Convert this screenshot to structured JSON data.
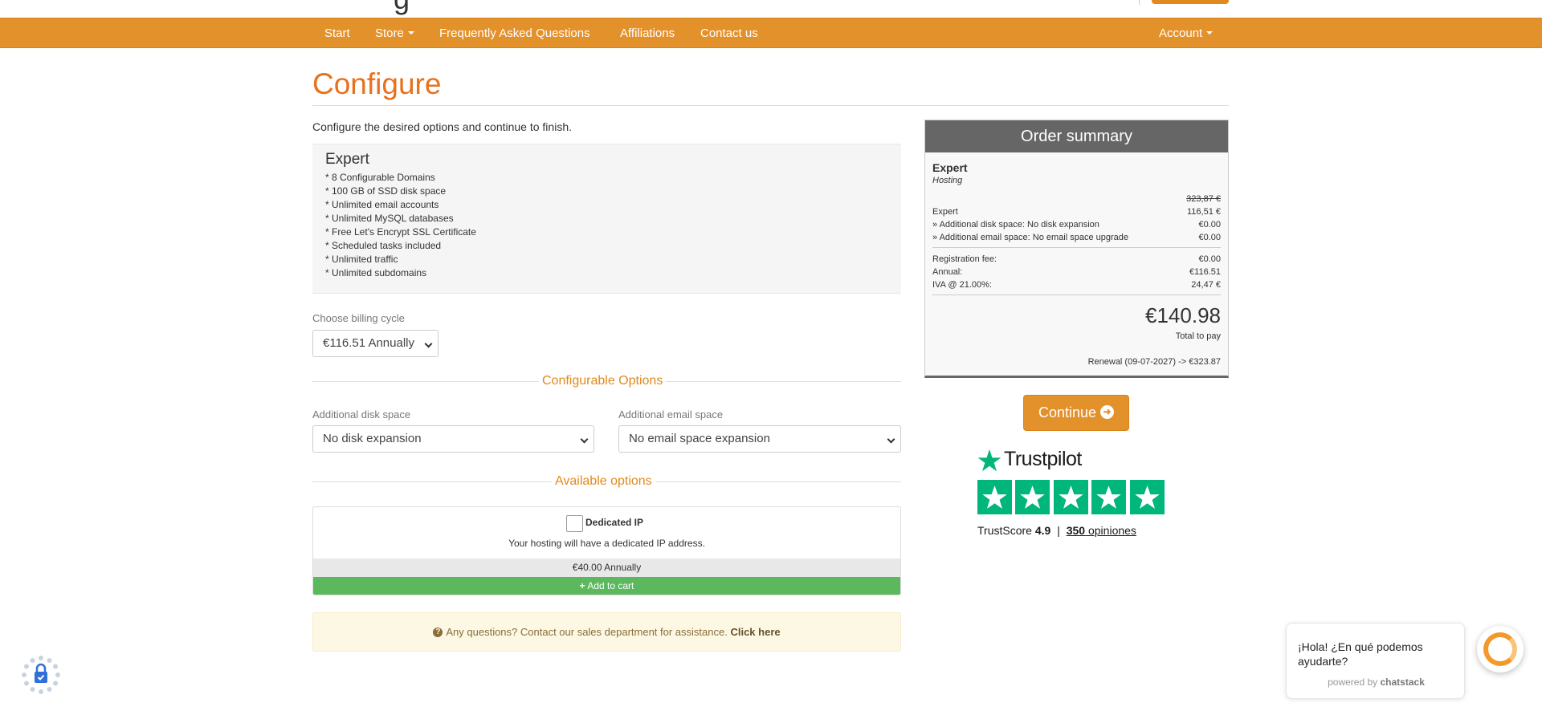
{
  "header": {
    "logo_fragment": "g"
  },
  "nav": {
    "start": "Start",
    "store": "Store",
    "faq": "Frequently Asked Questions",
    "affiliations": "Affiliations",
    "contact": "Contact us",
    "account": "Account"
  },
  "page": {
    "title": "Configure",
    "intro": "Configure the desired options and continue to finish."
  },
  "product": {
    "name": "Expert",
    "features": [
      "* 8 Configurable Domains",
      "* 100 GB of SSD disk space",
      "* Unlimited email accounts",
      "* Unlimited MySQL databases",
      "* Free Let's Encrypt SSL Certificate",
      "* Scheduled tasks included",
      "* Unlimited traffic",
      "* Unlimited subdomains"
    ]
  },
  "billing": {
    "label": "Choose billing cycle",
    "selected": "€116.51 Annually"
  },
  "configurable_options": {
    "title": "Configurable Options",
    "disk": {
      "label": "Additional disk space",
      "selected": "No disk expansion"
    },
    "email": {
      "label": "Additional email space",
      "selected": "No email space expansion"
    }
  },
  "available_options": {
    "title": "Available options",
    "addon_name": "Dedicated IP",
    "addon_desc": "Your hosting will have a dedicated IP address.",
    "addon_price": "€40.00 Annually",
    "add_to_cart": "Add to cart"
  },
  "help": {
    "text": "Any questions? Contact our sales department for assistance.",
    "link": "Click here"
  },
  "summary": {
    "title": "Order summary",
    "product": "Expert",
    "group": "Hosting",
    "old_price": "323,87 €",
    "lines": [
      {
        "label": "Expert",
        "value": "116,51 €"
      },
      {
        "label": "» Additional disk space: No disk expansion",
        "value": "€0.00"
      },
      {
        "label": "» Additional email space: No email space upgrade",
        "value": "€0.00"
      }
    ],
    "fees": [
      {
        "label": "Registration fee:",
        "value": "€0.00"
      },
      {
        "label": "Annual:",
        "value": "€116.51"
      },
      {
        "label": "IVA @ 21.00%:",
        "value": "24,47 €"
      }
    ],
    "total": "€140.98",
    "total_label": "Total to pay",
    "renewal": "Renewal (09-07-2027) -> €323.87"
  },
  "continue_label": "Continue",
  "trustpilot": {
    "brand": "Trustpilot",
    "score_label": "TrustScore",
    "score": "4.9",
    "separator": "|",
    "reviews_count": "350",
    "reviews_label": "opiniones",
    "stars": 5,
    "star_color": "#00b67a"
  },
  "chat": {
    "greeting": "¡Hola! ¿En qué podemos ayudarte?",
    "powered_by": "powered by",
    "brand": "chatstack"
  },
  "colors": {
    "accent": "#e3912b",
    "title_orange": "#e8711e",
    "success": "#5cb85c",
    "summary_header": "#666666"
  }
}
